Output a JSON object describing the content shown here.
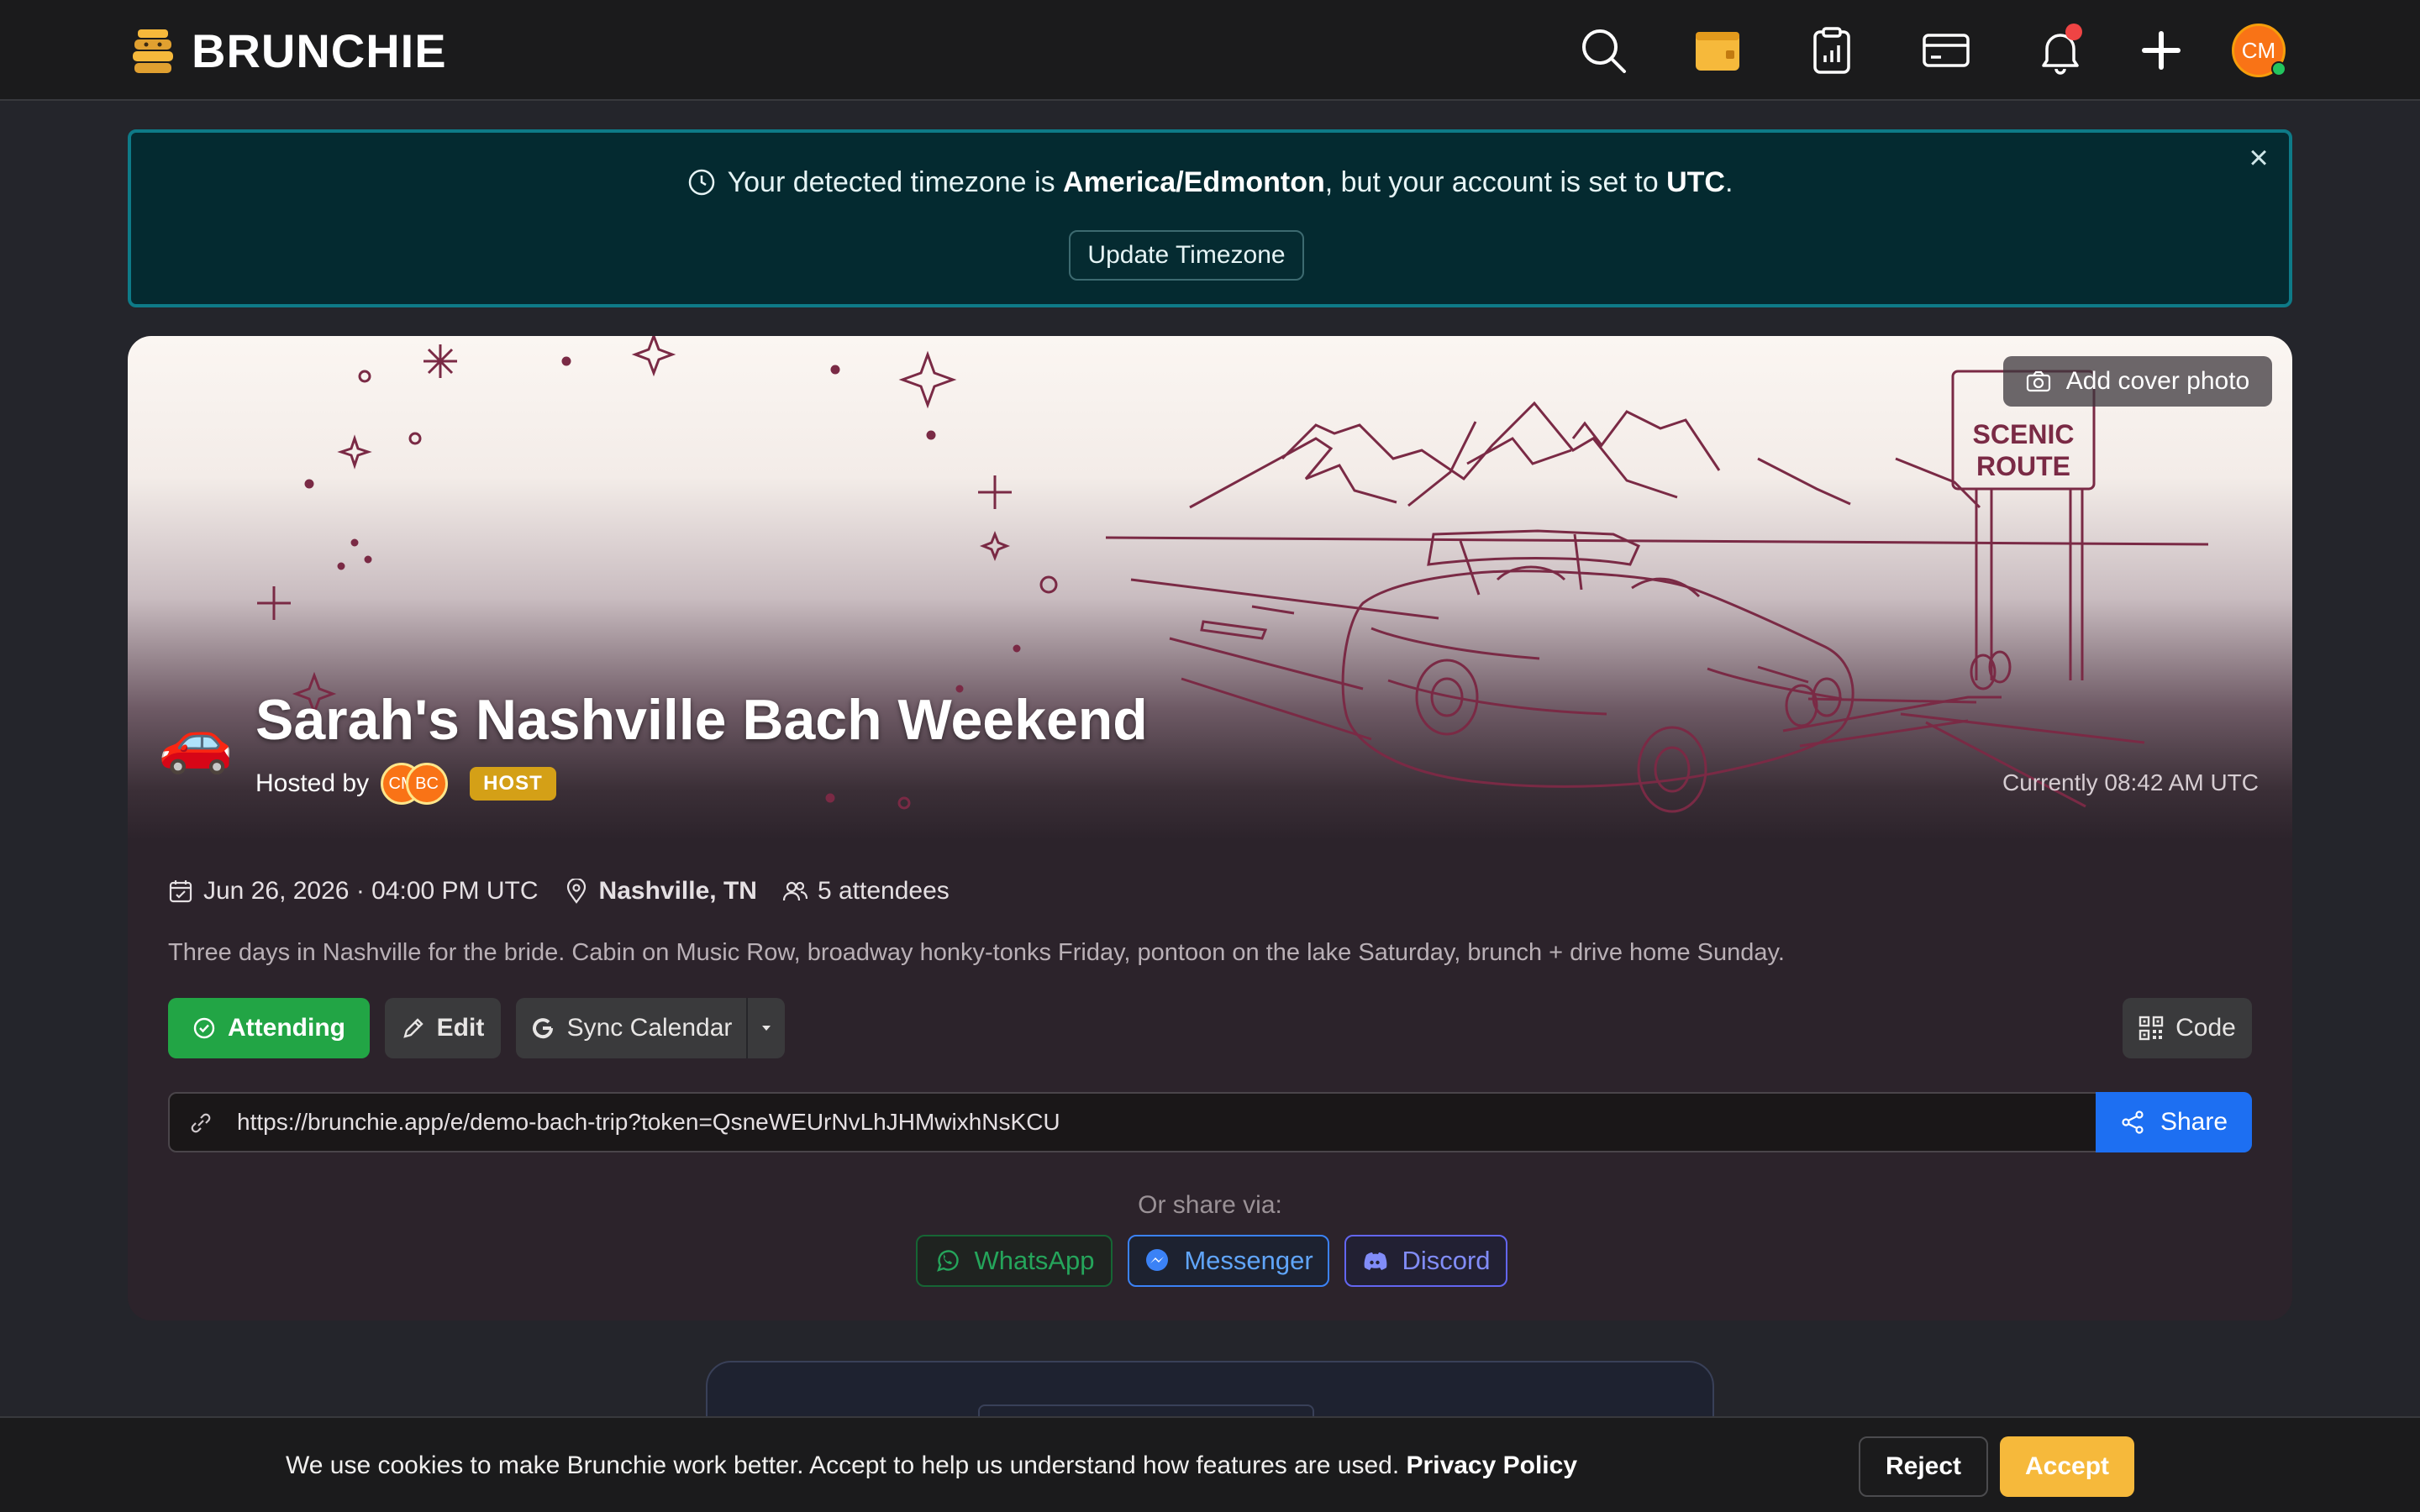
{
  "app": {
    "name": "BRUNCHIE"
  },
  "nav": {
    "icons": [
      "search-icon",
      "calendar-icon",
      "clipboard-chart-icon",
      "credit-card-icon",
      "bell-icon",
      "plus-icon"
    ],
    "avatar_initials": "CM"
  },
  "tz_banner": {
    "text_prefix": "Your detected timezone is ",
    "detected_tz": "America/Edmonton",
    "text_middle": ", but your account is set to ",
    "account_tz": "UTC",
    "text_suffix": ".",
    "button_label": "Update Timezone",
    "close_label": "×"
  },
  "event": {
    "cover_button_label": "Add cover photo",
    "emoji": "🚗",
    "title": "Sarah's Nashville Bach Weekend",
    "hosted_by_label": "Hosted by",
    "hosts": [
      "CM",
      "BC"
    ],
    "host_badge": "HOST",
    "current_time": "Currently 08:42 AM UTC",
    "date": "Jun 26, 2026 · 04:00 PM UTC",
    "location": "Nashville, TN",
    "attendees": "5 attendees",
    "description": "Three days in Nashville for the bride. Cabin on Music Row, broadway honky-tonks Friday, pontoon on the lake Saturday, brunch + drive home Sunday.",
    "sign_text_1": "SCENIC",
    "sign_text_2": "ROUTE"
  },
  "actions": {
    "attending_label": "Attending",
    "edit_label": "Edit",
    "sync_label": "Sync Calendar",
    "code_label": "Code"
  },
  "share": {
    "url": "https://brunchie.app/e/demo-bach-trip?token=QsneWEUrNvLhJHMwixhNsKCU",
    "share_label": "Share",
    "or_share_label": "Or share via:",
    "channels": [
      "WhatsApp",
      "Messenger",
      "Discord"
    ]
  },
  "cookie": {
    "text": "We use cookies to make Brunchie work better. Accept to help us understand how features are used. ",
    "policy_label": "Privacy Policy",
    "reject_label": "Reject",
    "accept_label": "Accept"
  },
  "colors": {
    "accent_green": "#22a545",
    "accent_blue": "#1d6ff2",
    "accent_yellow": "#f6b93b",
    "banner_teal": "#0e7a87"
  }
}
